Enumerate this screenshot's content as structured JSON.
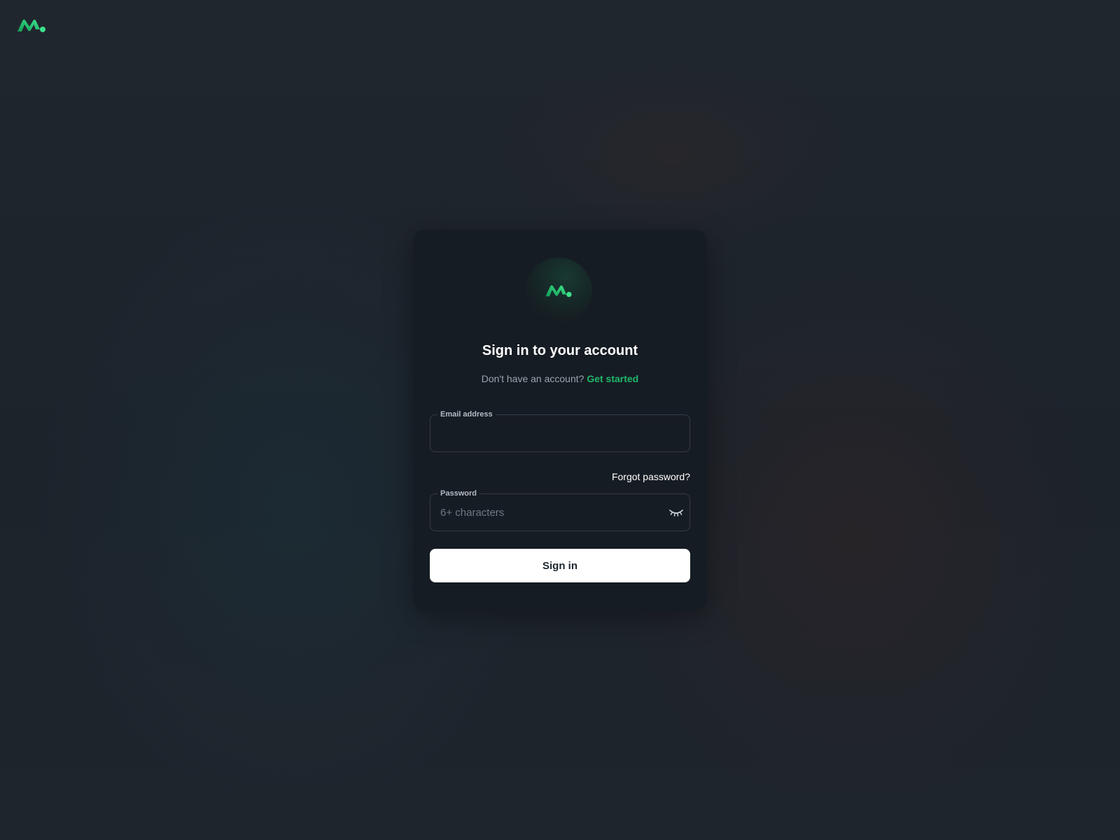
{
  "brand": {
    "logo_icon": "m-wave-logo-icon",
    "accent_colors": [
      "#1fb86a",
      "#3ee08a",
      "#0f9f58"
    ]
  },
  "card": {
    "title": "Sign in to your account",
    "subtitle_text": "Don't have an account?",
    "get_started_label": "Get started"
  },
  "email": {
    "label": "Email address",
    "value": ""
  },
  "forgot_label": "Forgot password?",
  "password": {
    "label": "Password",
    "placeholder": "6+ characters",
    "value": "",
    "visibility_icon": "eye-closed-icon"
  },
  "sign_in_label": "Sign in",
  "colors": {
    "background": "#1f252d",
    "card": "#161c23",
    "button": "#ffffff"
  }
}
